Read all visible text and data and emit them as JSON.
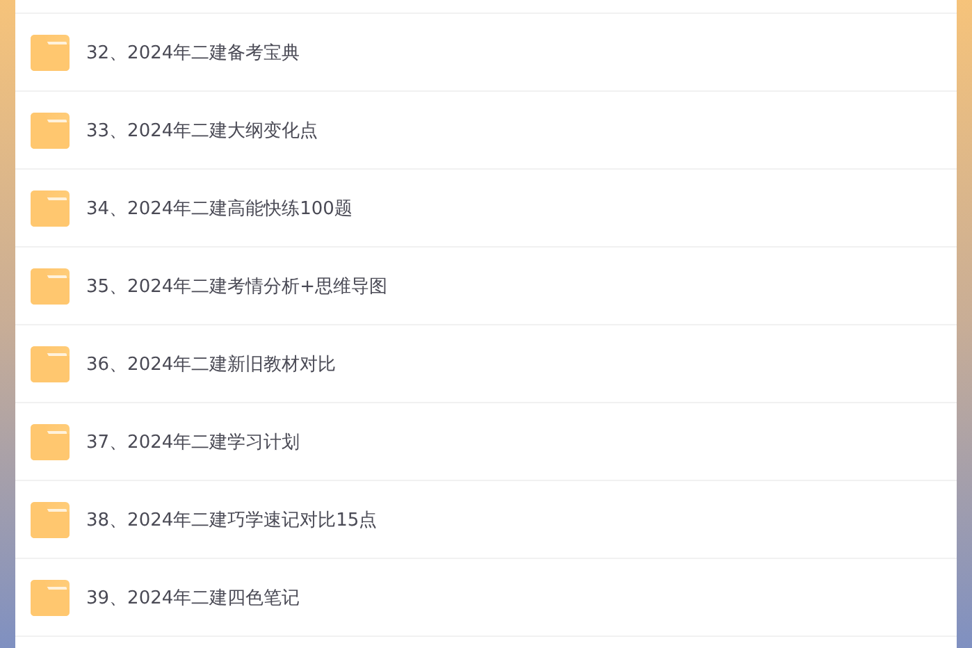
{
  "files": [
    {
      "name": "32、2024年二建备考宝典"
    },
    {
      "name": "33、2024年二建大纲变化点"
    },
    {
      "name": "34、2024年二建高能快练100题"
    },
    {
      "name": "35、2024年二建考情分析+思维导图"
    },
    {
      "name": "36、2024年二建新旧教材对比"
    },
    {
      "name": "37、2024年二建学习计划"
    },
    {
      "name": "38、2024年二建巧学速记对比15点"
    },
    {
      "name": "39、2024年二建四色笔记"
    }
  ]
}
